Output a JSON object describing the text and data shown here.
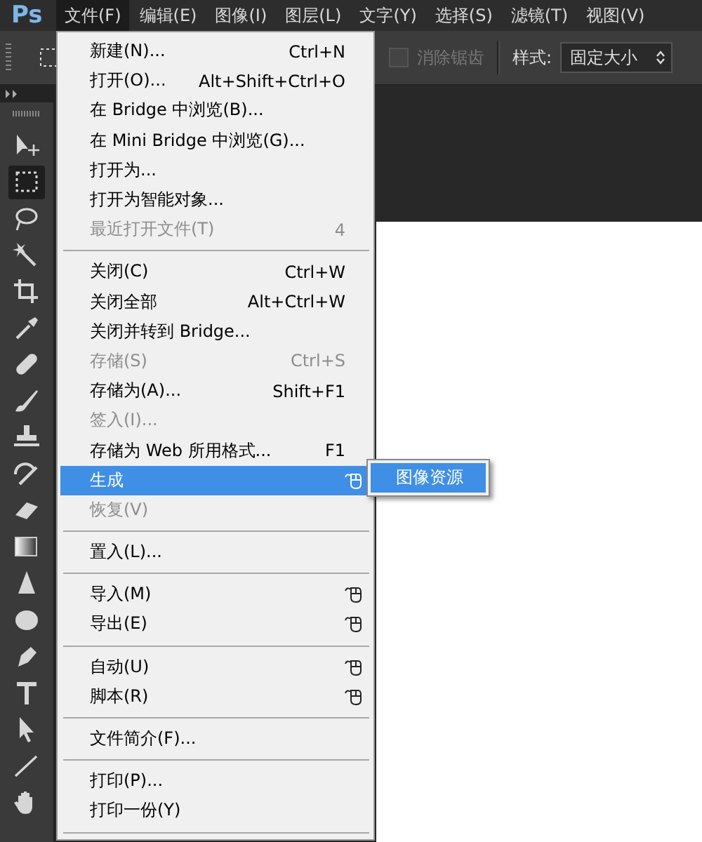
{
  "menu_bar": {
    "logo": "Ps",
    "items": [
      {
        "label": "文件(F)",
        "selected": true
      },
      {
        "label": "编辑(E)",
        "selected": false
      },
      {
        "label": "图像(I)",
        "selected": false
      },
      {
        "label": "图层(L)",
        "selected": false
      },
      {
        "label": "文字(Y)",
        "selected": false
      },
      {
        "label": "选择(S)",
        "selected": false
      },
      {
        "label": "滤镜(T)",
        "selected": false
      },
      {
        "label": "视图(V)",
        "selected": false
      }
    ]
  },
  "options_bar": {
    "antialias": {
      "label": "消除锯齿",
      "checked": false,
      "disabled": true
    },
    "style": {
      "label": "样式:",
      "value": "固定大小"
    }
  },
  "tools": [
    {
      "kind": "move",
      "selected": false
    },
    {
      "kind": "marquee",
      "selected": true
    },
    {
      "kind": "lasso",
      "selected": false
    },
    {
      "kind": "wand",
      "selected": false
    },
    {
      "kind": "crop",
      "selected": false
    },
    {
      "kind": "eyedropper",
      "selected": false
    },
    {
      "kind": "bandage",
      "selected": false
    },
    {
      "kind": "brush",
      "selected": false
    },
    {
      "kind": "stamp",
      "selected": false
    },
    {
      "kind": "history",
      "selected": false
    },
    {
      "kind": "eraser",
      "selected": false
    },
    {
      "kind": "gradient",
      "selected": false
    },
    {
      "kind": "blur",
      "selected": false
    },
    {
      "kind": "sponge",
      "selected": false
    },
    {
      "kind": "pen",
      "selected": false
    },
    {
      "kind": "type",
      "selected": false
    },
    {
      "kind": "select",
      "selected": false
    },
    {
      "kind": "line",
      "selected": false
    },
    {
      "kind": "hand",
      "selected": false
    }
  ],
  "file_menu": {
    "sections": [
      {
        "items": [
          {
            "label": "新建(N)...",
            "shortcut": "Ctrl+N",
            "disabled": false,
            "selected": false,
            "has_submenu": false
          },
          {
            "label": "打开(O)...",
            "shortcut": "Alt+Shift+Ctrl+O",
            "disabled": false,
            "selected": false,
            "has_submenu": false
          },
          {
            "label": "在 Bridge 中浏览(B)...",
            "disabled": false,
            "selected": false,
            "has_submenu": false
          },
          {
            "label": "在 Mini Bridge 中浏览(G)...",
            "disabled": false,
            "selected": false,
            "has_submenu": false
          },
          {
            "label": "打开为...",
            "disabled": false,
            "selected": false,
            "has_submenu": false
          },
          {
            "label": "打开为智能对象...",
            "disabled": false,
            "selected": false,
            "has_submenu": false
          },
          {
            "label": "最近打开文件(T)",
            "shortcut": "4",
            "disabled": true,
            "selected": false,
            "has_submenu": false
          }
        ]
      },
      {
        "items": [
          {
            "label": "关闭(C)",
            "shortcut": "Ctrl+W",
            "disabled": false,
            "selected": false,
            "has_submenu": false
          },
          {
            "label": "关闭全部",
            "shortcut": "Alt+Ctrl+W",
            "disabled": false,
            "selected": false,
            "has_submenu": false
          },
          {
            "label": "关闭并转到 Bridge...",
            "disabled": false,
            "selected": false,
            "has_submenu": false
          },
          {
            "label": "存储(S)",
            "shortcut": "Ctrl+S",
            "disabled": true,
            "selected": false,
            "has_submenu": false
          },
          {
            "label": "存储为(A)...",
            "shortcut": "Shift+F1",
            "disabled": false,
            "selected": false,
            "has_submenu": false
          },
          {
            "label": "签入(I)...",
            "disabled": true,
            "selected": false,
            "has_submenu": false
          },
          {
            "label": "存储为 Web 所用格式...",
            "shortcut": "F1",
            "disabled": false,
            "selected": false,
            "has_submenu": false
          },
          {
            "label": "生成",
            "disabled": false,
            "selected": true,
            "has_submenu": true
          },
          {
            "label": "恢复(V)",
            "disabled": true,
            "selected": false,
            "has_submenu": false
          }
        ]
      },
      {
        "items": [
          {
            "label": "置入(L)...",
            "disabled": false,
            "selected": false,
            "has_submenu": false
          }
        ]
      },
      {
        "items": [
          {
            "label": "导入(M)",
            "disabled": false,
            "selected": false,
            "has_submenu": true
          },
          {
            "label": "导出(E)",
            "disabled": false,
            "selected": false,
            "has_submenu": true
          }
        ]
      },
      {
        "items": [
          {
            "label": "自动(U)",
            "disabled": false,
            "selected": false,
            "has_submenu": true
          },
          {
            "label": "脚本(R)",
            "disabled": false,
            "selected": false,
            "has_submenu": true
          }
        ]
      },
      {
        "items": [
          {
            "label": "文件简介(F)...",
            "disabled": false,
            "selected": false,
            "has_submenu": false
          }
        ]
      },
      {
        "items": [
          {
            "label": "打印(P)...",
            "disabled": false,
            "selected": false,
            "has_submenu": false
          },
          {
            "label": "打印一份(Y)",
            "disabled": false,
            "selected": false,
            "has_submenu": false
          }
        ]
      }
    ]
  },
  "submenu": {
    "items": [
      {
        "label": "图像资源",
        "selected": true
      }
    ]
  }
}
